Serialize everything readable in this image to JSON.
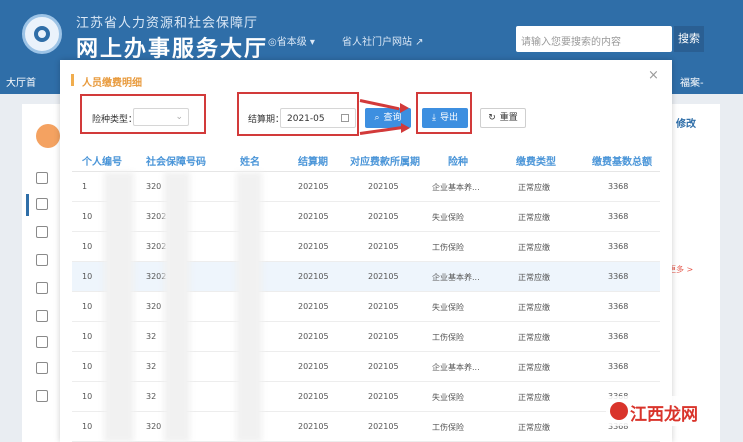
{
  "header": {
    "org_name": "江苏省人力资源和社会保障厅",
    "site_title": "网上办事服务大厅",
    "region": "◎省本级 ▾",
    "portal_link": "省人社门户网站 ↗",
    "search_placeholder": "请输入您要搜索的内容",
    "search_button": "搜索"
  },
  "navbar": {
    "first_item": "大厅首",
    "last_item": "福案-"
  },
  "right_panel": {
    "edit_link": "修改",
    "more_link": "更多 >"
  },
  "modal": {
    "title": "人员缴费明细",
    "close_glyph": "×",
    "filters": {
      "insurance_type_label": "险种类型：",
      "insurance_type_value": "",
      "settlement_period_label": "结算期：",
      "settlement_period_value": "2021-05"
    },
    "buttons": {
      "query": "查询",
      "export": "导出",
      "reset": "重置"
    },
    "table": {
      "columns": [
        "个人编号",
        "社会保障号码",
        "姓名",
        "结算期",
        "对应费款所属期",
        "险种",
        "缴费类型",
        "缴费基数总额"
      ],
      "rows": [
        {
          "id": "1",
          "ssn": "320",
          "name": "",
          "period": "202105",
          "belong": "202105",
          "type": "企业基本养...",
          "pay_type": "正常应缴",
          "base": "3368"
        },
        {
          "id": "10",
          "ssn": "3202",
          "name": "",
          "period": "202105",
          "belong": "202105",
          "type": "失业保险",
          "pay_type": "正常应缴",
          "base": "3368"
        },
        {
          "id": "10",
          "ssn": "3202",
          "name": "",
          "period": "202105",
          "belong": "202105",
          "type": "工伤保险",
          "pay_type": "正常应缴",
          "base": "3368"
        },
        {
          "id": "10",
          "ssn": "3202",
          "name": "",
          "period": "202105",
          "belong": "202105",
          "type": "企业基本养...",
          "pay_type": "正常应缴",
          "base": "3368"
        },
        {
          "id": "10",
          "ssn": "320",
          "name": "",
          "period": "202105",
          "belong": "202105",
          "type": "失业保险",
          "pay_type": "正常应缴",
          "base": "3368"
        },
        {
          "id": "10",
          "ssn": "32",
          "name": "",
          "period": "202105",
          "belong": "202105",
          "type": "工伤保险",
          "pay_type": "正常应缴",
          "base": "3368"
        },
        {
          "id": "10",
          "ssn": "32",
          "name": "",
          "period": "202105",
          "belong": "202105",
          "type": "企业基本养...",
          "pay_type": "正常应缴",
          "base": "3368"
        },
        {
          "id": "10",
          "ssn": "32",
          "name": "",
          "period": "202105",
          "belong": "202105",
          "type": "失业保险",
          "pay_type": "正常应缴",
          "base": "3368"
        },
        {
          "id": "10",
          "ssn": "320",
          "name": "",
          "period": "202105",
          "belong": "202105",
          "type": "工伤保险",
          "pay_type": "正常应缴",
          "base": "3368"
        }
      ]
    }
  },
  "watermark": {
    "text": "江西龙网"
  },
  "colors": {
    "header_blue": "#2f6ea8",
    "accent_blue": "#3d8fe0",
    "table_header_blue": "#4a95d8",
    "annotation_red": "#d23a3a",
    "title_orange": "#e89a3c"
  }
}
